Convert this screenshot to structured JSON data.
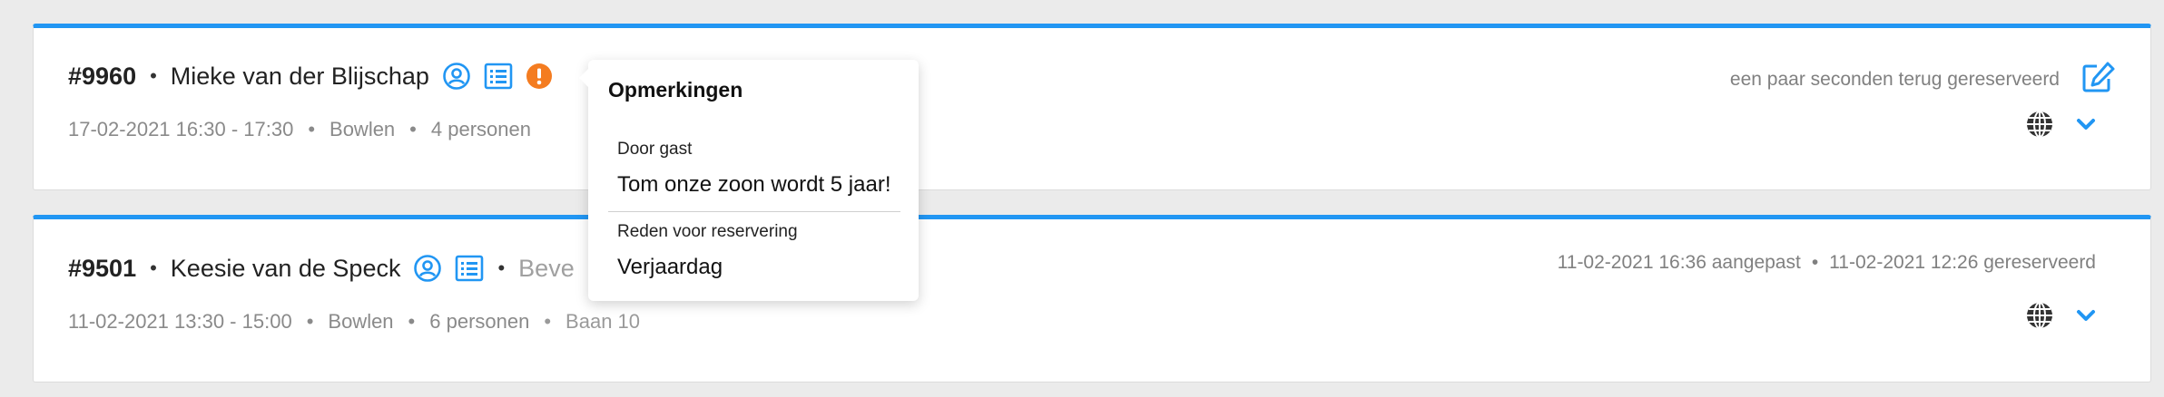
{
  "reservations": [
    {
      "number": "#9960",
      "name": "Mieke van der Blijschap",
      "date": "17-02-2021 16:30 - 17:30",
      "activity": "Bowlen",
      "persons": "4 personen",
      "status_text": "een paar seconden terug gereserveerd"
    },
    {
      "number": "#9501",
      "name": "Keesie van de Speck",
      "extra": "Beve",
      "date": "11-02-2021 13:30 - 15:00",
      "activity": "Bowlen",
      "persons": "6 personen",
      "lane": "Baan 10",
      "modified_text": "11-02-2021 16:36 aangepast",
      "reserved_text": "11-02-2021 12:26 gereserveerd"
    }
  ],
  "separator": "•",
  "popover": {
    "title": "Opmerkingen",
    "sections": [
      {
        "label": "Door gast",
        "value": "Tom onze zoon wordt 5 jaar!"
      },
      {
        "label": "Reden voor reservering",
        "value": "Verjaardag"
      }
    ]
  },
  "colors": {
    "accent": "#2196f3",
    "warning": "#f47c20",
    "icon_dark": "#333333"
  },
  "icons": [
    "user-circle-icon",
    "list-icon",
    "exclamation-icon",
    "edit-icon",
    "globe-icon",
    "chevron-down-icon"
  ]
}
